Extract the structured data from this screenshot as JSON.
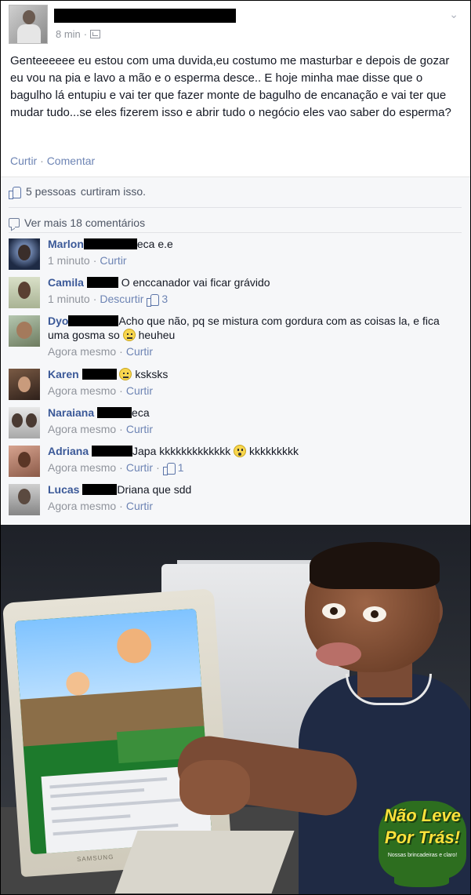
{
  "post": {
    "time": "8 min",
    "text": "Genteeeeee eu estou com uma duvida,eu costumo me masturbar e depois de gozar eu vou na pia e lavo a mão e o esperma desce.. E hoje minha mae disse que o bagulho lá entupiu e vai ter que fazer monte de bagulho de encanação e vai ter que mudar tudo...se eles fizerem isso e abrir tudo o negócio eles vao saber do esperma?",
    "like_label": "Curtir",
    "comment_label": "Comentar",
    "separator": "·"
  },
  "ufi": {
    "likes_count": "5 pessoas",
    "likes_suffix": "curtiram isso.",
    "more_comments": "Ver mais 18 comentários"
  },
  "comments": [
    {
      "name": "Marlon",
      "text": "eca e.e",
      "time": "1 minuto",
      "action": "Curtir",
      "likes": ""
    },
    {
      "name": "Camila",
      "text": "O enccanador vai ficar grávido",
      "time": "1 minuto",
      "action": "Descurtir",
      "likes": "3"
    },
    {
      "name": "Dyo",
      "text": "Acho que não, pq se mistura com gordura com as coisas la, e fica uma gosma so",
      "text2": "heuheu",
      "time": "Agora mesmo",
      "action": "Curtir",
      "likes": ""
    },
    {
      "name": "Karen",
      "text": "ksksks",
      "time": "Agora mesmo",
      "action": "Curtir",
      "likes": ""
    },
    {
      "name": "Naraiana",
      "text": "eca",
      "time": "Agora mesmo",
      "action": "Curtir",
      "likes": ""
    },
    {
      "name": "Adriana",
      "text": "Japa kkkkkkkkkkkkk",
      "text2": "kkkkkkkkk",
      "time": "Agora mesmo",
      "action": "Curtir",
      "likes": "1"
    },
    {
      "name": "Lucas",
      "text": "Driana que sdd",
      "time": "Agora mesmo",
      "action": "Curtir",
      "likes": ""
    }
  ],
  "meme": {
    "logo_line1": "Não Leve",
    "logo_line2": "Por Trás!",
    "logo_tagline": "Nossas brincadeiras e claro!",
    "monitor_brand": "SAMSUNG"
  },
  "icons": {
    "post_chevron": "chevron-down-icon",
    "audience": "friends-audience-icon",
    "like": "thumbs-up-icon",
    "comments": "comment-bubble-icon",
    "emoji_unsure": "unsure-emoji-icon",
    "emoji_gasp": "gasp-emoji-icon"
  },
  "colors": {
    "link": "#3b5998",
    "action_link": "#6d84b4",
    "meta_gray": "#90949c",
    "ufi_bg": "#f6f7f9",
    "logo_green": "#2d6e1f",
    "logo_yellow": "#ffe23b"
  }
}
